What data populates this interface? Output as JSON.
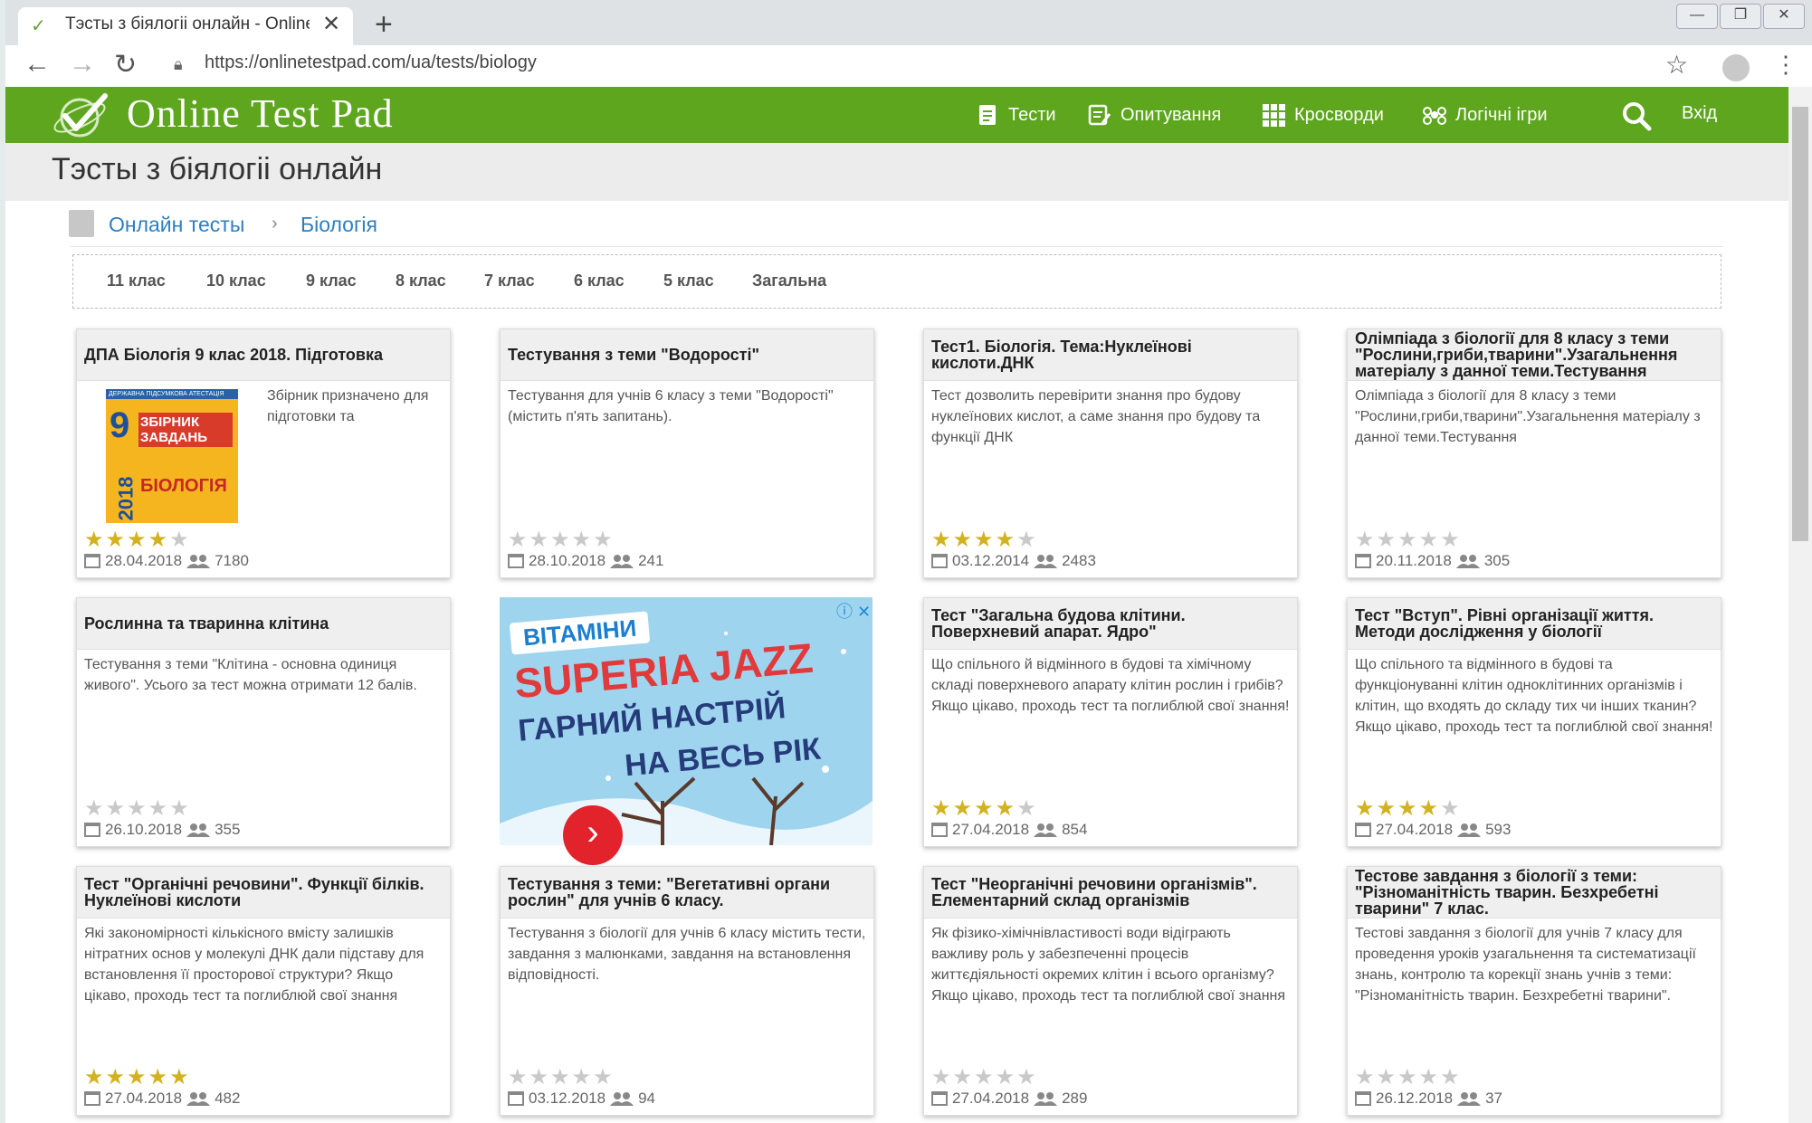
{
  "browser": {
    "tab_title": "Тэсты з біялогіі онлайн - Online",
    "new_tab": "+",
    "tab_close": "✕",
    "url": "https://onlinetestpad.com/ua/tests/biology",
    "window_buttons": [
      "—",
      "❐",
      "✕"
    ]
  },
  "header": {
    "logo": "Online Test Pad",
    "nav": [
      "Тести",
      "Опитування",
      "Кросворди",
      "Логічні ігри"
    ],
    "login": "Вхід"
  },
  "page": {
    "title": "Тэсты з біялогіі онлайн",
    "breadcrumb": [
      "Онлайн тесты",
      "Біологія"
    ],
    "grades": [
      "11 клас",
      "10 клас",
      "9 клас",
      "8 клас",
      "7 клас",
      "6 клас",
      "5 клас",
      "Загальна"
    ]
  },
  "cards": [
    {
      "title": "ДПА Біологія 9 клас 2018. Підготовка",
      "desc": "Збірник призначено для підготовки та",
      "rating": 4,
      "date": "28.04.2018",
      "users": "7180",
      "book": {
        "top": "ДЕРЖАВНА ПІДСУМКОВА АТЕСТАЦІЯ",
        "grade": "9",
        "heading": "ЗБІРНИК ЗАВДАНЬ",
        "year": "2018",
        "subject": "БІОЛОГІЯ"
      }
    },
    {
      "title": "Тестування з теми \"Водорості\"",
      "desc": "Тестування для учнів 6 класу з теми \"Водорості\" (містить п'ять запитань).",
      "rating": 0,
      "date": "28.10.2018",
      "users": "241"
    },
    {
      "title": "Тест1. Біологія. Тема:Нуклеїнові кислоти.ДНК",
      "desc": "Тест дозволить перевірити знання про будову нуклеїнових кислот, а саме знання про будову та функції ДНК",
      "rating": 4,
      "date": "03.12.2014",
      "users": "2483"
    },
    {
      "title": "Олімпіада з біології для 8 класу з теми \"Рослини,гриби,тварини\".Узагальнення матеріалу з данної теми.Тестування",
      "desc": "Олімпіада з біології для 8 класу з теми \"Рослини,гриби,тварини\".Узагальнення матеріалу з данної теми.Тестування",
      "rating": 0,
      "date": "20.11.2018",
      "users": "305"
    },
    {
      "title": "Рослинна та тваринна клітина",
      "desc": "Тестування з теми \"Клітина - основна одиниця живого\". Усього за тест можна отримати 12 балів.",
      "rating": 0,
      "date": "26.10.2018",
      "users": "355"
    },
    {
      "title": "Тест \"Загальна будова клітини. Поверхневий апарат. Ядро\"",
      "desc": "Що спільного й відмінного в будові та хімічному складі поверхневого апарату клітин рослин і грибів? Якщо цікаво, проходь тест та поглиблюй свої знання!",
      "rating": 4,
      "date": "27.04.2018",
      "users": "854"
    },
    {
      "title": "Тест \"Вступ\". Рівні організації життя. Методи дослідження у біології",
      "desc": "Що спільного та відмінного в будові та функціонуванні клітин одноклітинних організмів і клітин, що входять до складу тих чи інших тканин? Якщо цікаво, проходь тест та поглиблюй свої знання!",
      "rating": 4,
      "date": "27.04.2018",
      "users": "593"
    },
    {
      "title": "Тест \"Органічні речовини\". Функції білків. Нуклеїнові кислоти",
      "desc": "Які закономірності кількісного вмісту залишків нітратних основ у молекулі ДНК дали підставу для встановлення її просторової структури? Якщо цікаво, проходь тест та поглиблюй свої знання",
      "rating": 5,
      "date": "27.04.2018",
      "users": "482"
    },
    {
      "title": "Тестування з теми: \"Вегетативні органи рослин\" для учнів 6 класу.",
      "desc": "Тестування з біології для учнів 6 класу містить тести, завдання з малюнками, завдання на встановлення відповідності.",
      "rating": 0,
      "date": "03.12.2018",
      "users": "94"
    },
    {
      "title": "Тест \"Неорганічні речовини організмів\". Елементарний склад організмів",
      "desc": "Як фізико-хімічнівластивості води відіграють важливу роль у забезпеченні процесів життєдіяльності окремих клітин і всього організму? Якщо цікаво, проходь тест та поглиблюй свої знання",
      "rating": 0,
      "date": "27.04.2018",
      "users": "289"
    },
    {
      "title": "Тестове завдання з біології з теми: \"Різноманітність тварин. Безхребетні тварини\" 7 клас.",
      "desc": "Тестові завдання з біології для учнів 7 класу для проведення уроків узагальнення та систематизації знань, контролю та корекції знань учнів з теми: \"Різноманітність тварин. Безхребетні тварини\".",
      "rating": 0,
      "date": "26.12.2018",
      "users": "37"
    }
  ],
  "ad": {
    "badge": "ⓘ ✕",
    "tag": "ВІТАМІНИ",
    "brand": "SUPERIA JAZZ",
    "line1": "ГАРНИЙ НАСТРІЙ",
    "line2": "НА ВЕСЬ РІК",
    "play": "›"
  },
  "colors": {
    "brand_green": "#5da61e",
    "link_blue": "#2d7fc0",
    "star_gold": "#d2b21f"
  }
}
